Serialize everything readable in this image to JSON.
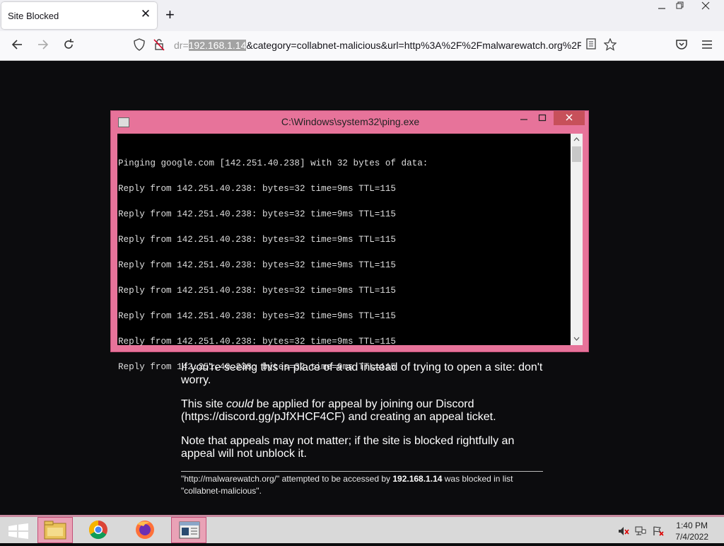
{
  "browser": {
    "tab_title": "Site Blocked",
    "tab_close": "✕",
    "new_tab": "+",
    "url_prefix": "dr=",
    "url_selected": "192.168.1.14",
    "url_rest": "&category=collabnet-malicious&url=http%3A%2F%2Fmalwarewatch.org%2F"
  },
  "console": {
    "title": "C:\\Windows\\system32\\ping.exe",
    "lines": [
      "Pinging google.com [142.251.40.238] with 32 bytes of data:",
      "Reply from 142.251.40.238: bytes=32 time=9ms TTL=115",
      "Reply from 142.251.40.238: bytes=32 time=9ms TTL=115",
      "Reply from 142.251.40.238: bytes=32 time=9ms TTL=115",
      "Reply from 142.251.40.238: bytes=32 time=9ms TTL=115",
      "Reply from 142.251.40.238: bytes=32 time=9ms TTL=115",
      "Reply from 142.251.40.238: bytes=32 time=9ms TTL=115",
      "Reply from 142.251.40.238: bytes=32 time=9ms TTL=115",
      "Reply from 142.251.40.238: bytes=32 time=9ms TTL=115"
    ]
  },
  "page": {
    "p1": "If you're seeing this in place of a ad instead of trying to open a site: don't worry.",
    "p2_before": "This site ",
    "p2_italic": "could",
    "p2_after": " be applied for appeal by joining our Discord (https://discord.gg/pJfXHCF4CF) and creating an appeal ticket.",
    "p3": "Note that appeals may not matter; if the site is blocked rightfully an appeal will not unblock it.",
    "footer_before": "\"http://malwarewatch.org/\" attempted to be accessed by ",
    "footer_ip": "192.168.1.14",
    "footer_after": " was blocked in list \"collabnet-malicious\"."
  },
  "taskbar": {
    "time": "1:40 PM",
    "date": "7/4/2022",
    "apps": [
      "file-explorer-icon",
      "chrome-icon",
      "firefox-icon",
      "console-icon"
    ]
  },
  "colors": {
    "window_frame": "#e7739a",
    "close_button": "#c7505a",
    "page_background": "#0c0c0e"
  }
}
